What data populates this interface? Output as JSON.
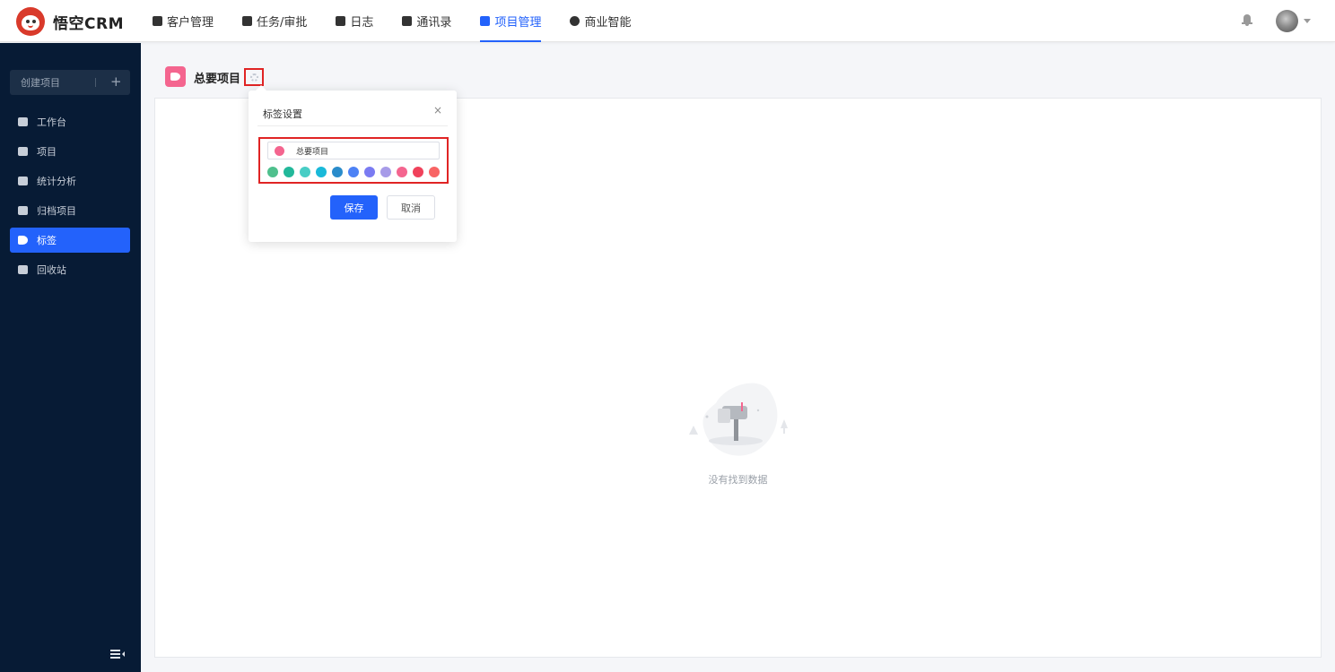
{
  "app": {
    "logo_text": "悟空CRM"
  },
  "nav": {
    "items": [
      {
        "label": "客户管理",
        "icon": "building-icon"
      },
      {
        "label": "任务/审批",
        "icon": "briefcase-icon"
      },
      {
        "label": "日志",
        "icon": "journal-icon"
      },
      {
        "label": "通讯录",
        "icon": "contacts-icon"
      },
      {
        "label": "项目管理",
        "icon": "project-icon",
        "active": true
      },
      {
        "label": "商业智能",
        "icon": "shield-icon"
      }
    ]
  },
  "sidebar": {
    "create_label": "创建项目",
    "create_plus": "+",
    "items": [
      {
        "label": "工作台",
        "icon": "monitor-icon"
      },
      {
        "label": "项目",
        "icon": "list-icon"
      },
      {
        "label": "统计分析",
        "icon": "bar-chart-icon"
      },
      {
        "label": "归档项目",
        "icon": "archive-icon"
      },
      {
        "label": "标签",
        "icon": "tag-icon",
        "active": true
      },
      {
        "label": "回收站",
        "icon": "trash-icon"
      }
    ]
  },
  "page": {
    "title": "总要项目"
  },
  "popover": {
    "title": "标签设置",
    "close": "×",
    "tag_value": "总要项目",
    "selected_color": "#f4658f",
    "colors": [
      "#4fc08d",
      "#22b89a",
      "#48cdc5",
      "#19b9d9",
      "#2a8ccb",
      "#4d82f5",
      "#7a7bf2",
      "#a79be8",
      "#f4658f",
      "#f0425b",
      "#f86464"
    ],
    "save_label": "保存",
    "cancel_label": "取消"
  },
  "empty": {
    "text": "没有找到数据"
  }
}
